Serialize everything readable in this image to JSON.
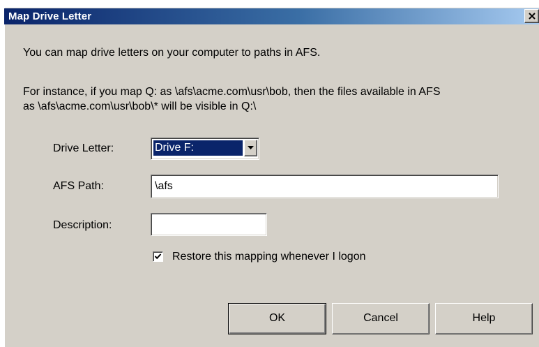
{
  "window": {
    "title": "Map Drive Letter",
    "close_glyph": "close-icon"
  },
  "intro": {
    "line1": "You can map drive letters on your computer to paths in AFS.",
    "line2": "For instance, if you map Q: as \\afs\\acme.com\\usr\\bob, then the files available in AFS",
    "line3": "as \\afs\\acme.com\\usr\\bob\\* will be visible in Q:\\"
  },
  "form": {
    "drive_letter_label": "Drive Letter:",
    "drive_letter_value": "Drive F:",
    "afs_path_label": "AFS Path:",
    "afs_path_value": "\\afs",
    "description_label": "Description:",
    "description_value": "",
    "restore_label": "Restore this mapping whenever I logon",
    "restore_checked": true
  },
  "buttons": {
    "ok": "OK",
    "cancel": "Cancel",
    "help": "Help"
  },
  "colors": {
    "face": "#d4d0c8",
    "titlebar_start": "#0a246a",
    "titlebar_end": "#a6caf0",
    "selection": "#0a246a"
  }
}
